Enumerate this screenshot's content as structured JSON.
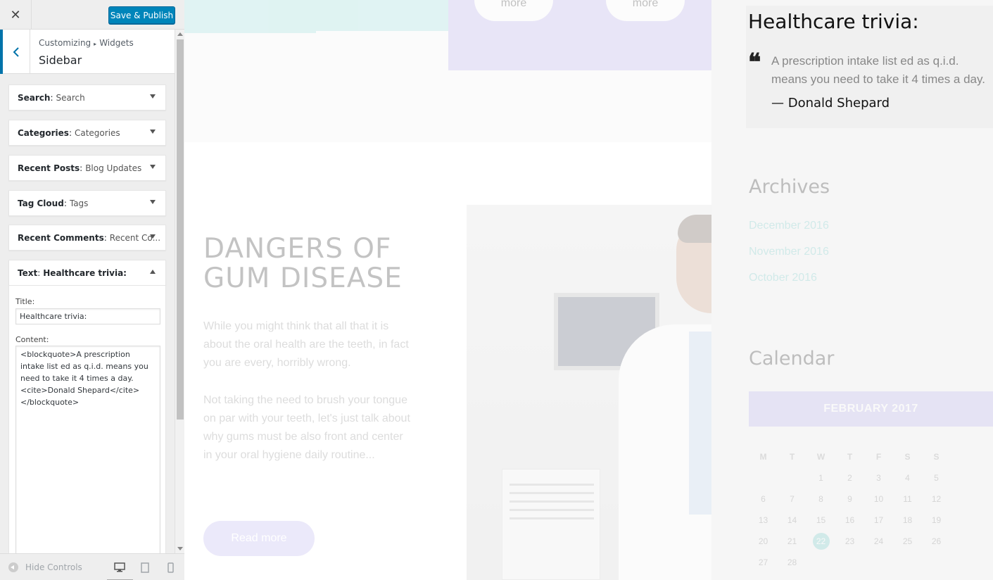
{
  "customizer": {
    "close_glyph": "✕",
    "publish_label": "Save & Publish",
    "breadcrumb": {
      "root": "Customizing",
      "sep": "▸",
      "child": "Widgets"
    },
    "panel_title": "Sidebar",
    "widgets": [
      {
        "type": "Search",
        "title": "Search"
      },
      {
        "type": "Categories",
        "title": "Categories"
      },
      {
        "type": "Recent Posts",
        "title": "Blog Updates"
      },
      {
        "type": "Tag Cloud",
        "title": "Tags"
      },
      {
        "type": "Recent Comments",
        "title": "Recent Co..."
      },
      {
        "type": "Text",
        "title": "Healthcare trivia:"
      }
    ],
    "open_widget": {
      "title_label": "Title:",
      "title_value": "Healthcare trivia:",
      "content_label": "Content:",
      "content_value": "<blockquote>A prescription intake list ed as q.i.d. means you need to take it 4 times a day.<cite>Donald Shepard</cite></blockquote>"
    },
    "footer": {
      "hide_controls_label": "Hide Controls"
    }
  },
  "preview": {
    "more_label": "more",
    "article": {
      "title": "DANGERS OF GUM DISEASE",
      "paragraph_1": "While you might think that all that it is about the oral health are the teeth, in fact you are every, horribly wrong.",
      "paragraph_2": "Not taking the need to brush your tongue on par with your teeth, let's just talk about why gums must be also front and center in your oral hygiene daily routine...",
      "read_more": "Read more"
    },
    "trivia": {
      "title": "Healthcare trivia:",
      "quote": "A prescription intake list ed as q.i.d. means you need to take it 4 times a day.",
      "cite": "— Donald Shepard"
    },
    "archives": {
      "title": "Archives",
      "links": [
        "December 2016",
        "November 2016",
        "October 2016"
      ]
    },
    "calendar": {
      "title": "Calendar",
      "month": "FEBRUARY 2017",
      "weekdays": [
        "M",
        "T",
        "W",
        "T",
        "F",
        "S",
        "S"
      ],
      "weeks": [
        [
          "",
          "",
          "1",
          "2",
          "3",
          "4",
          "5"
        ],
        [
          "6",
          "7",
          "8",
          "9",
          "10",
          "11",
          "12"
        ],
        [
          "13",
          "14",
          "15",
          "16",
          "17",
          "18",
          "19"
        ],
        [
          "20",
          "21",
          "22",
          "23",
          "24",
          "25",
          "26"
        ],
        [
          "27",
          "28",
          "",
          "",
          "",
          "",
          ""
        ]
      ],
      "today": "22"
    }
  },
  "colors": {
    "accent_blue": "#0085ba",
    "teal": "#8dd4d2",
    "lavender": "#c7bff0"
  }
}
